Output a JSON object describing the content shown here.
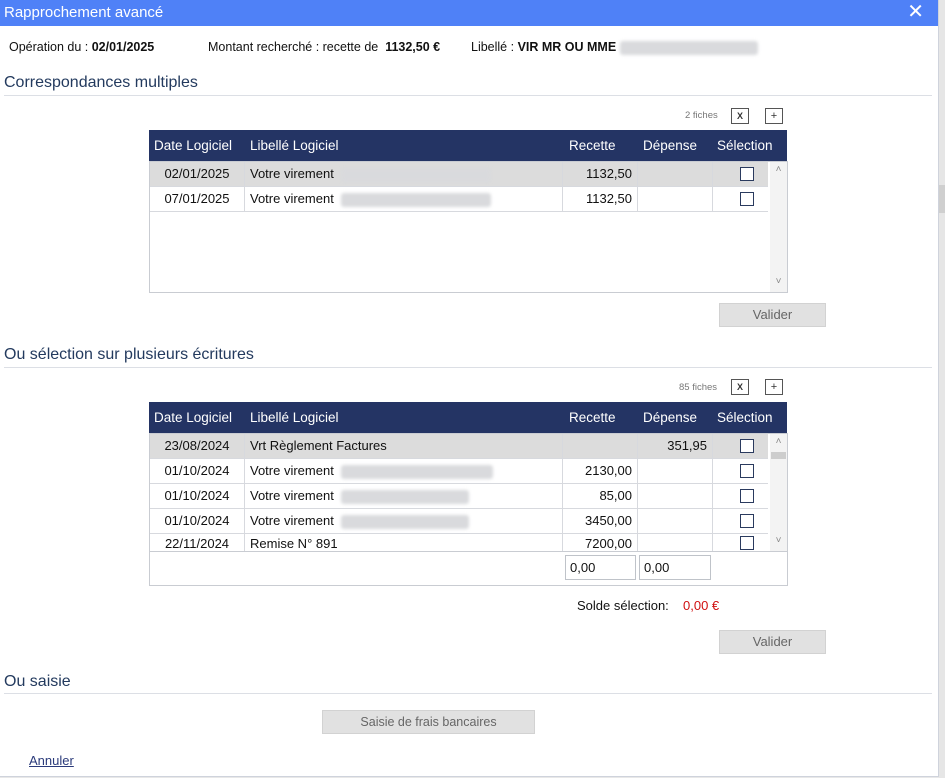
{
  "window": {
    "title": "Rapprochement avancé",
    "close": "✕"
  },
  "info": {
    "operation_label": "Opération du :",
    "operation_date": "02/01/2025",
    "montant_label": "Montant recherché : recette de",
    "montant_value": "1132,50 €",
    "libelle_label": "Libellé :",
    "libelle_value": "VIR MR OU MME"
  },
  "section1": {
    "title": "Correspondances multiples",
    "count": "2 fiches",
    "columns": [
      "Date Logiciel",
      "Libellé Logiciel",
      "Recette",
      "Dépense",
      "Sélection"
    ],
    "rows": [
      {
        "date": "02/01/2025",
        "libelle": "Votre virement",
        "recette": "1132,50",
        "depense": ""
      },
      {
        "date": "07/01/2025",
        "libelle": "Votre virement",
        "recette": "1132,50",
        "depense": ""
      }
    ],
    "valider": "Valider"
  },
  "section2": {
    "title": "Ou sélection sur plusieurs écritures",
    "count": "85 fiches",
    "columns": [
      "Date Logiciel",
      "Libellé Logiciel",
      "Recette",
      "Dépense",
      "Sélection"
    ],
    "rows": [
      {
        "date": "23/08/2024",
        "libelle": "Vrt Règlement Factures",
        "recette": "",
        "depense": "351,95"
      },
      {
        "date": "01/10/2024",
        "libelle": "Votre virement",
        "recette": "2130,00",
        "depense": ""
      },
      {
        "date": "01/10/2024",
        "libelle": "Votre virement",
        "recette": "85,00",
        "depense": ""
      },
      {
        "date": "01/10/2024",
        "libelle": "Votre virement",
        "recette": "3450,00",
        "depense": ""
      },
      {
        "date": "22/11/2024",
        "libelle": "Remise N° 891",
        "recette": "7200,00",
        "depense": ""
      }
    ],
    "total_recette": "0,00",
    "total_depense": "0,00",
    "solde_label": "Solde sélection:",
    "solde_value": "0,00 €",
    "valider": "Valider"
  },
  "section3": {
    "title": "Ou saisie",
    "button": "Saisie de frais bancaires"
  },
  "annuler": "Annuler",
  "icons": {
    "excel": "excel-export-icon",
    "plus": "add-icon"
  },
  "colors": {
    "titlebar": "#4f81f7",
    "header": "#243464",
    "negative": "#d01010"
  }
}
